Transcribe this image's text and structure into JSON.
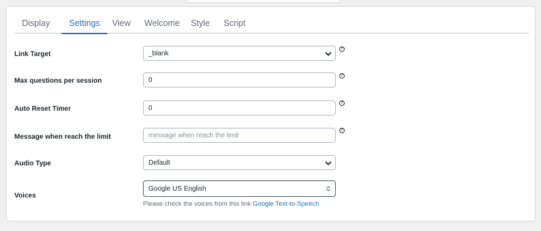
{
  "tabs": [
    {
      "label": "Display",
      "active": false
    },
    {
      "label": "Settings",
      "active": true
    },
    {
      "label": "View",
      "active": false
    },
    {
      "label": "Welcome",
      "active": false
    },
    {
      "label": "Style",
      "active": false
    },
    {
      "label": "Script",
      "active": false
    }
  ],
  "fields": {
    "link_target": {
      "label": "Link Target",
      "value": "_blank"
    },
    "max_questions": {
      "label": "Max questions per session",
      "value": "0"
    },
    "auto_reset": {
      "label": "Auto Reset Timer",
      "value": "0"
    },
    "limit_message": {
      "label": "Message when reach the limit",
      "value": "",
      "placeholder": "message when reach the limit"
    },
    "audio_type": {
      "label": "Audio Type",
      "value": "Default"
    },
    "voices": {
      "label": "Voices",
      "value": "Google US English"
    }
  },
  "help_glyph": "?",
  "voices_hint": {
    "text": "Please check the voices from this link ",
    "link_text": "Google Text-to-Speech"
  },
  "colors": {
    "accent": "#2e6db4",
    "link": "#2271b1",
    "background": "#f0f0f1"
  }
}
